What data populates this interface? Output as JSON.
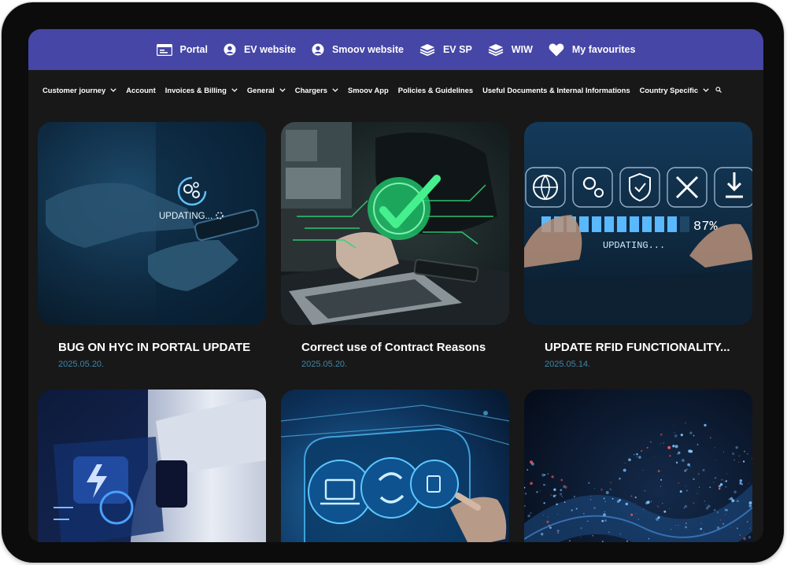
{
  "topbar": {
    "links": [
      {
        "label": "Portal",
        "icon": "portal-icon"
      },
      {
        "label": "EV website",
        "icon": "user-circle-icon"
      },
      {
        "label": "Smoov website",
        "icon": "user-circle-icon"
      },
      {
        "label": "EV SP",
        "icon": "stack-icon"
      },
      {
        "label": "WIW",
        "icon": "stack-icon"
      },
      {
        "label": "My favourites",
        "icon": "heart-icon"
      }
    ]
  },
  "nav": {
    "items": [
      {
        "label": "Customer journey",
        "dropdown": true
      },
      {
        "label": "Account",
        "dropdown": false
      },
      {
        "label": "Invoices & Billing",
        "dropdown": true
      },
      {
        "label": "General",
        "dropdown": true
      },
      {
        "label": "Chargers",
        "dropdown": true
      },
      {
        "label": "Smoov App",
        "dropdown": false
      },
      {
        "label": "Policies & Guidelines",
        "dropdown": false
      },
      {
        "label": "Useful Documents & Internal Informations",
        "dropdown": false
      },
      {
        "label": "Country Specific",
        "dropdown": true
      }
    ],
    "search_icon": "search-icon"
  },
  "posts": [
    {
      "title": "BUG ON HYC IN PORTAL UPDATE",
      "date": "2025.05.20.",
      "overlay_text": "UPDATING..."
    },
    {
      "title": "Correct use of Contract Reasons",
      "date": "2025.05.20."
    },
    {
      "title": "UPDATE RFID FUNCTIONALITY...",
      "date": "2025.05.14.",
      "overlay_text": "UPDATING...",
      "overlay_percent": "87%"
    },
    {
      "title": "",
      "date": ""
    },
    {
      "title": "",
      "date": ""
    },
    {
      "title": "",
      "date": ""
    }
  ],
  "colors": {
    "topbar": "#4546a6",
    "background": "#181818",
    "date": "#3f87a8",
    "accent_green": "#2fd47a"
  }
}
